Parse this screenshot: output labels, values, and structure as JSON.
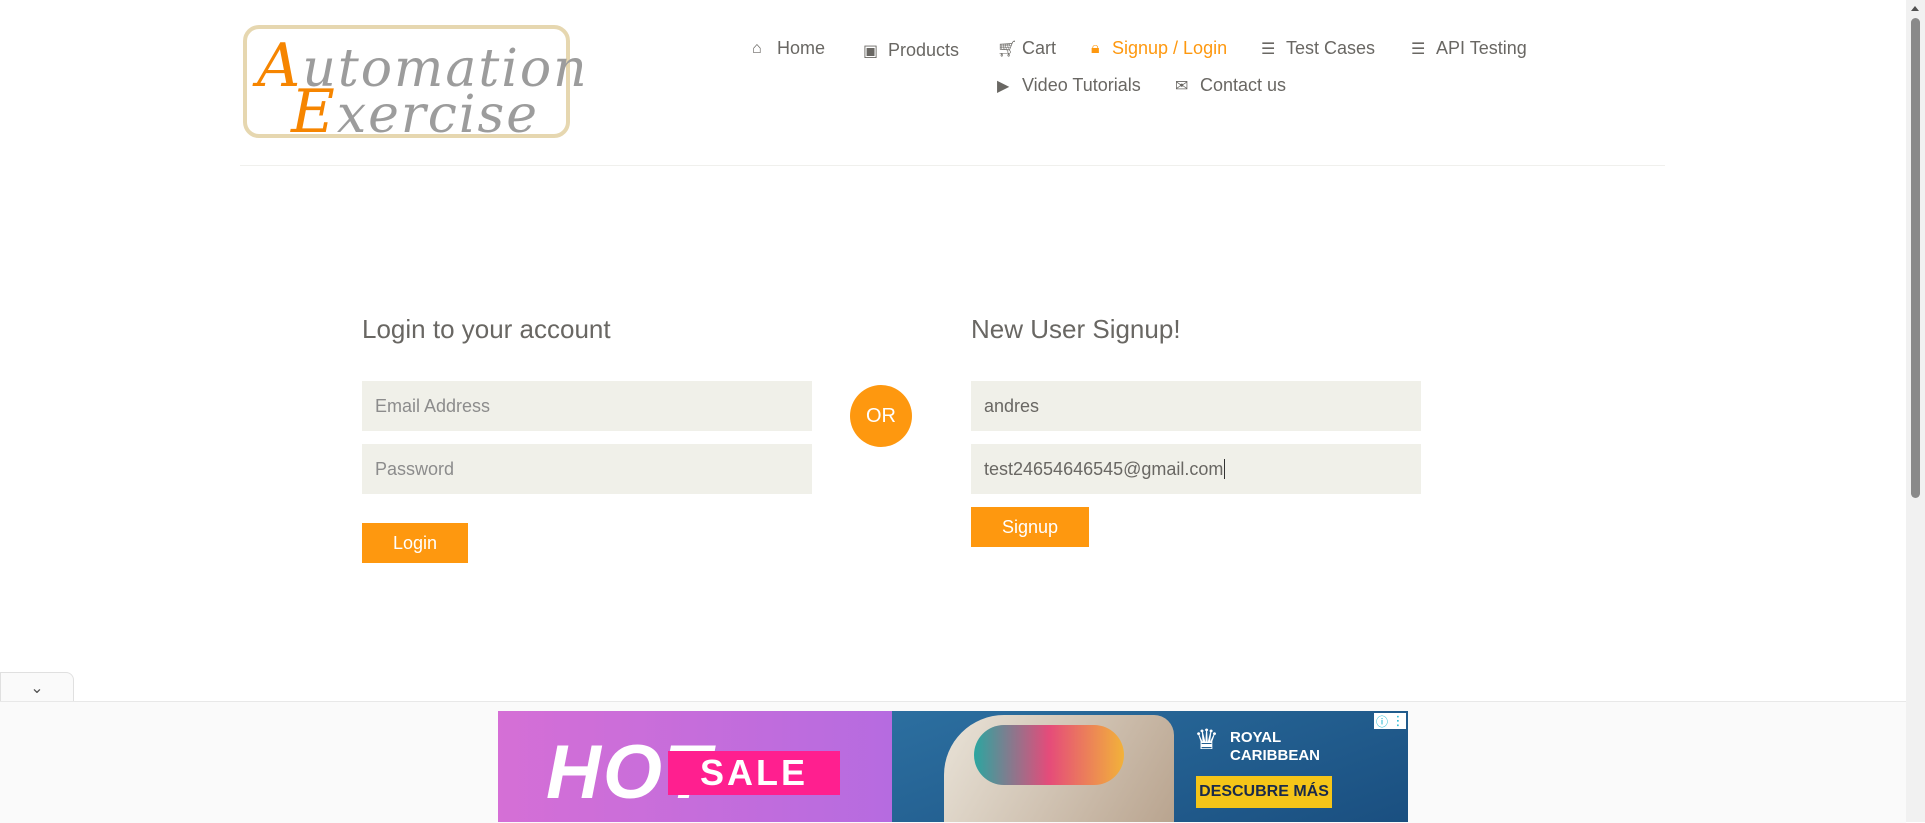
{
  "logo": {
    "line1_cap": "A",
    "line1_rest": "utomation",
    "line2_cap": "E",
    "line2_rest": "xercise"
  },
  "nav": {
    "home": "Home",
    "products": "Products",
    "cart": "Cart",
    "signup_login": "Signup / Login",
    "test_cases": "Test Cases",
    "api_testing": "API Testing",
    "video_tutorials": "Video Tutorials",
    "contact_us": "Contact us",
    "active": "signup_login"
  },
  "login": {
    "title": "Login to your account",
    "email_placeholder": "Email Address",
    "password_placeholder": "Password",
    "button": "Login"
  },
  "separator": "OR",
  "signup": {
    "title": "New User Signup!",
    "name_value": "andres",
    "email_value": "test24654646545@gmail.com",
    "button": "Signup"
  },
  "ad": {
    "hot": "HOT",
    "sale": "SALE",
    "brand_line1": "ROYAL",
    "brand_line2": "CARIBBEAN",
    "cta": "DESCUBRE MÁS"
  },
  "colors": {
    "accent": "#fe980f",
    "input_bg": "#f0f0e9",
    "text": "#696763"
  },
  "icons": {
    "home": "home-icon",
    "products": "briefcase-icon",
    "cart": "cart-icon",
    "signup_login": "lock-icon",
    "test_cases": "list-icon",
    "api_testing": "list-icon",
    "video_tutorials": "youtube-icon",
    "contact_us": "envelope-icon"
  }
}
